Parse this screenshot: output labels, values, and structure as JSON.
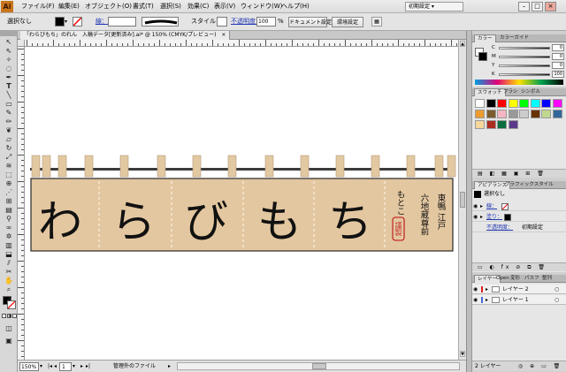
{
  "menubar": {
    "logo": "Ai",
    "items": [
      "ファイル(F)",
      "編集(E)",
      "オブジェクト(O)",
      "書式(T)",
      "選択(S)",
      "効果(C)",
      "表示(V)",
      "ウィンドウ(W)",
      "ヘルプ(H)"
    ],
    "workspace": "初期設定 ▾",
    "win_minimize": "–",
    "win_restore": "□",
    "win_close": "×"
  },
  "controlbar": {
    "selection": "選択なし",
    "stroke_label": "線：",
    "style_label": "スタイル：",
    "opacity_label": "不透明度：",
    "opacity_value": "100",
    "opacity_unit": "%",
    "doc_settings": "ドキュメント設定",
    "prefs": "環境設定"
  },
  "document": {
    "tab_title": "「わらびもち」のれん　入稿データ[更新済み].ai* @ 150% (CMYK/プレビュー)",
    "tab_close": "×",
    "artwork": {
      "big_chars": [
        "わ",
        "ら",
        "び",
        "も",
        "ち"
      ],
      "shop_col1": "東鴨 江戸",
      "shop_col2": "六地蔵尊前",
      "shop_col3": "もとこ",
      "seal": "謹製"
    }
  },
  "statusbar": {
    "zoom": "150%",
    "page": "1",
    "info": "管理外のファイル"
  },
  "panels": {
    "color_tabs": [
      "カラー",
      "カラーガイド"
    ],
    "sliders": [
      {
        "label": "C",
        "value": "0"
      },
      {
        "label": "M",
        "value": "0"
      },
      {
        "label": "Y",
        "value": "0"
      },
      {
        "label": "K",
        "value": "100"
      }
    ],
    "swatch_tabs": [
      "スウォッチ",
      "ブラシ",
      "シンボル"
    ],
    "swatches": [
      "#ffffff",
      "#000000",
      "#ff0000",
      "#ffff00",
      "#00ff00",
      "#00ffff",
      "#0000ff",
      "#ff00ff",
      "#ec9b2f",
      "#7a5c2e",
      "#f4b6c2",
      "#999999",
      "#cccccc",
      "#663300",
      "#c0d890",
      "#336699",
      "#f5d69b",
      "#ac2c20",
      "#0a6d3d",
      "#5a3a8a"
    ],
    "appearance_tabs": [
      "アピアランス",
      "グラフィックスタイル"
    ],
    "appearance_title": "選択なし",
    "appearance_rows": [
      {
        "label": "線：",
        "value": ""
      },
      {
        "label": "塗り：",
        "value": ""
      },
      {
        "label": "不透明度：",
        "value": "初期設定"
      }
    ],
    "layer_tabs": [
      "レイヤー",
      "Open",
      "変形",
      "パスフ",
      "整列"
    ],
    "layers": [
      {
        "name": "レイヤー 2",
        "color": "#e02020"
      },
      {
        "name": "レイヤー 1",
        "color": "#4a68d8"
      }
    ],
    "layer_count": "2 レイヤー"
  },
  "colors": {
    "noren_fill": "#e3c7a0",
    "clip_fill": "#e3c9a2",
    "ink": "#111111",
    "seal_red": "#c42d2d"
  }
}
